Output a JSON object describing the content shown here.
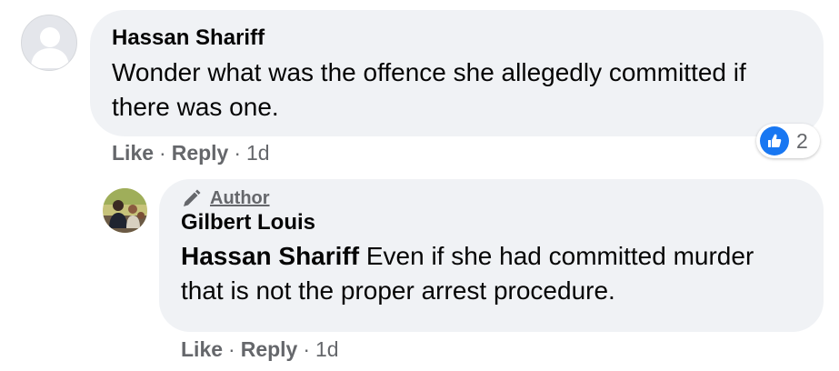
{
  "comment": {
    "author": "Hassan Shariff",
    "text": "Wonder what was the offence she allegedly committed if there was one.",
    "actions": {
      "like": "Like",
      "reply": "Reply",
      "time": "1d",
      "separator": "·"
    },
    "reaction": {
      "icon": "thumbs-up-icon",
      "count": "2",
      "color": "#1877f2"
    }
  },
  "reply": {
    "badge": "Author",
    "badge_icon": "pencil-icon",
    "author": "Gilbert Louis",
    "mention": "Hassan Shariff",
    "text": "Even if she had committed murder that is not the proper arrest procedure.",
    "actions": {
      "like": "Like",
      "reply": "Reply",
      "time": "1d",
      "separator": "·"
    }
  }
}
